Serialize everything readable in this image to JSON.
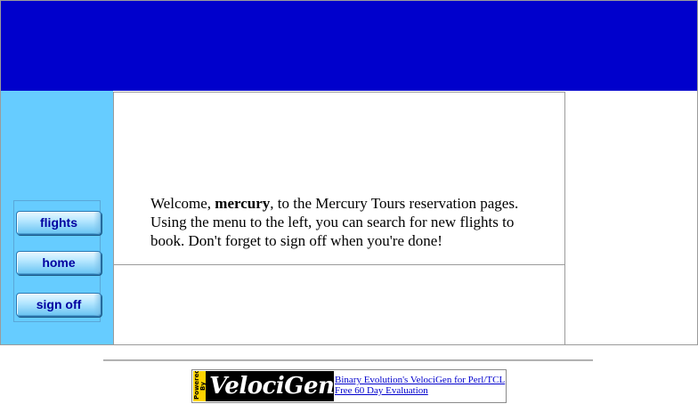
{
  "welcome": {
    "prefix": "Welcome, ",
    "username": "mercury",
    "suffix": ", to the Mercury Tours reservation pages. Using the menu to the left, you can search for new flights to book. Don't forget to sign off when you're done!"
  },
  "menu": {
    "items": [
      {
        "label": "flights"
      },
      {
        "label": "home"
      },
      {
        "label": "sign off"
      }
    ]
  },
  "footer": {
    "logo": {
      "tag": "Powered By",
      "name": "VelociGen!"
    },
    "links": [
      "Binary Evolution's VelociGen for Perl/TCL",
      "Free 60 Day Evaluation"
    ]
  },
  "colors": {
    "banner": "#0000cc",
    "sidebar": "#66ccff",
    "text": "#000000",
    "link": "#0000cc",
    "menu_text": "#0000a0"
  },
  "icons": {
    "logo": "velocigen-logo"
  }
}
